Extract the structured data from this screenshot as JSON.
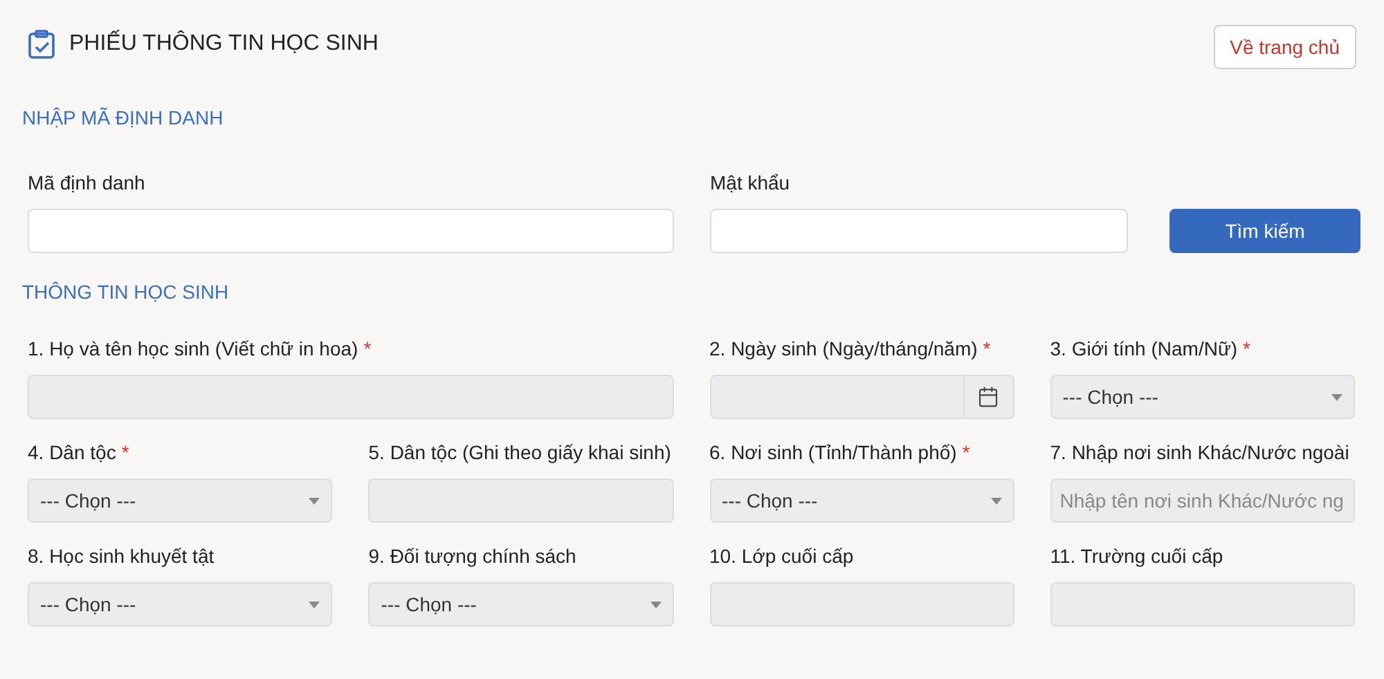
{
  "header": {
    "title": "PHIẾU THÔNG TIN HỌC SINH",
    "home_button": "Về trang chủ"
  },
  "required_mark": "*",
  "lookup": {
    "heading": "NHẬP MÃ ĐỊNH DANH",
    "fields": [
      {
        "label": "Mã định danh"
      },
      {
        "label": "Mật khẩu"
      }
    ],
    "search_button": "Tìm kiếm"
  },
  "student": {
    "heading": "THÔNG TIN HỌC SINH",
    "fields": [
      {
        "label": "1. Họ và tên học sinh (Viết chữ in hoa)",
        "kind": "text",
        "wide": true,
        "required": true
      },
      {
        "label": "2. Ngày sinh (Ngày/tháng/năm)",
        "kind": "date",
        "wide": false,
        "required": true
      },
      {
        "label": "3. Giới tính (Nam/Nữ)",
        "kind": "select",
        "wide": false,
        "required": true,
        "value": "--- Chọn ---"
      },
      {
        "label": "4. Dân tộc",
        "kind": "select",
        "wide": false,
        "required": true,
        "value": "--- Chọn ---"
      },
      {
        "label": "5. Dân tộc (Ghi theo giấy khai sinh)",
        "kind": "text",
        "wide": false,
        "required": false
      },
      {
        "label": "6. Nơi sinh (Tỉnh/Thành phố)",
        "kind": "select",
        "wide": false,
        "required": true,
        "value": "--- Chọn ---"
      },
      {
        "label": "7. Nhập nơi sinh Khác/Nước ngoài",
        "kind": "text",
        "wide": false,
        "required": false,
        "placeholder": "Nhập tên nơi sinh Khác/Nước ng"
      },
      {
        "label": "8. Học sinh khuyết tật",
        "kind": "select",
        "wide": false,
        "required": false,
        "value": "--- Chọn ---"
      },
      {
        "label": "9. Đối tượng chính sách",
        "kind": "select",
        "wide": false,
        "required": false,
        "value": "--- Chọn ---"
      },
      {
        "label": "10. Lớp cuối cấp",
        "kind": "text",
        "wide": false,
        "required": false
      },
      {
        "label": "11. Trường cuối cấp",
        "kind": "text",
        "wide": false,
        "required": false
      }
    ]
  }
}
